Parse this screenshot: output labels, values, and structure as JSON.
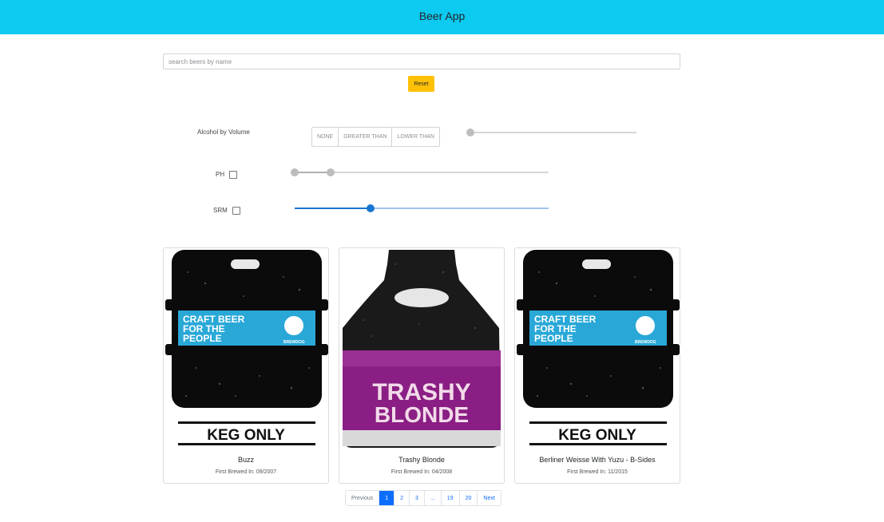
{
  "header": {
    "title": "Beer App"
  },
  "search": {
    "placeholder": "search beers by name",
    "value": ""
  },
  "reset_label": "Reset",
  "filters": {
    "abv": {
      "label": "Alcohol by Volume",
      "options": [
        "NONE",
        "GREATER THAN",
        "LOWER THAN"
      ],
      "slider_value": 0
    },
    "ph": {
      "label": "PH",
      "checked": false,
      "range": [
        0,
        20
      ]
    },
    "srm": {
      "label": "SRM",
      "checked": false,
      "value": 30
    }
  },
  "beers": [
    {
      "name": "Buzz",
      "first_brewed": "First Brewed In: 09/2007",
      "image": "keg",
      "keg_text": "KEG ONLY",
      "label_text": [
        "CRAFT BEER",
        "FOR THE",
        "PEOPLE"
      ],
      "brand": "BREWDOG"
    },
    {
      "name": "Trashy Blonde",
      "first_brewed": "First Brewed In: 04/2008",
      "image": "bottle",
      "label_text": [
        "TRASHY",
        "BLONDE"
      ]
    },
    {
      "name": "Berliner Weisse With Yuzu - B-Sides",
      "first_brewed": "First Brewed In: 11/2015",
      "image": "keg",
      "keg_text": "KEG ONLY",
      "label_text": [
        "CRAFT BEER",
        "FOR THE",
        "PEOPLE"
      ],
      "brand": "BREWDOG"
    }
  ],
  "pagination": {
    "previous": "Previous",
    "pages": [
      "1",
      "2",
      "3",
      "...",
      "19",
      "20"
    ],
    "active": "1",
    "next": "Next"
  },
  "colors": {
    "navbar": "#0dcaf0",
    "reset": "#ffc107",
    "primary": "#0d6efd",
    "slider_active": "#1976d2"
  }
}
